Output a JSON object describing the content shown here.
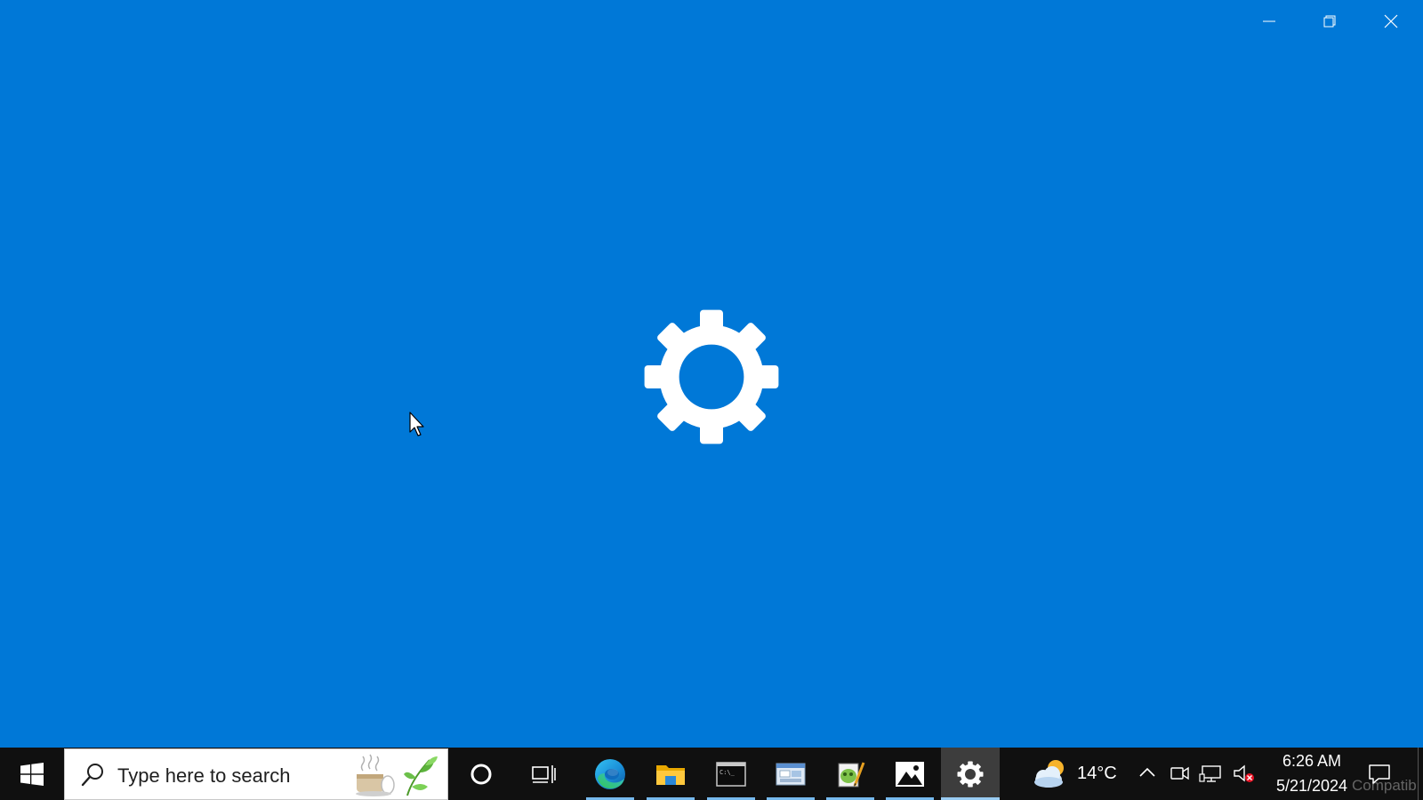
{
  "window": {
    "title": "Settings",
    "background_color": "#0078d7",
    "caption_buttons": {
      "minimize": "minimize-icon",
      "restore": "restore-icon",
      "close": "close-icon"
    },
    "splash_icon": "gear-icon"
  },
  "taskbar": {
    "background_color": "#101010",
    "search": {
      "placeholder": "Type here to search"
    },
    "pinned_apps": [
      {
        "name": "Cortana",
        "icon": "cortana-circle-icon"
      },
      {
        "name": "Task View",
        "icon": "task-view-icon"
      },
      {
        "name": "Microsoft Edge",
        "icon": "edge-icon",
        "running": true
      },
      {
        "name": "File Explorer",
        "icon": "folder-icon",
        "running": true
      },
      {
        "name": "Command Prompt",
        "icon": "terminal-icon",
        "running": true
      },
      {
        "name": "Control Panel",
        "icon": "control-panel-icon",
        "running": true
      },
      {
        "name": "Notepad++",
        "icon": "notepad-icon",
        "running": true
      },
      {
        "name": "Photos",
        "icon": "photos-icon",
        "running": true
      },
      {
        "name": "Settings",
        "icon": "gear-icon",
        "running": true,
        "active": true
      }
    ],
    "weather": {
      "temperature": "14°C",
      "icon": "cloudy-sun-icon"
    },
    "tray_icons": [
      "chevron-up-icon",
      "meet-now-icon",
      "network-icon",
      "volume-muted-icon"
    ],
    "clock": {
      "time": "6:26 AM",
      "date": "5/21/2024"
    },
    "watermark_text": "Compatib",
    "notification_icon": "notification-icon",
    "accent_underline": "#76b9ed"
  }
}
